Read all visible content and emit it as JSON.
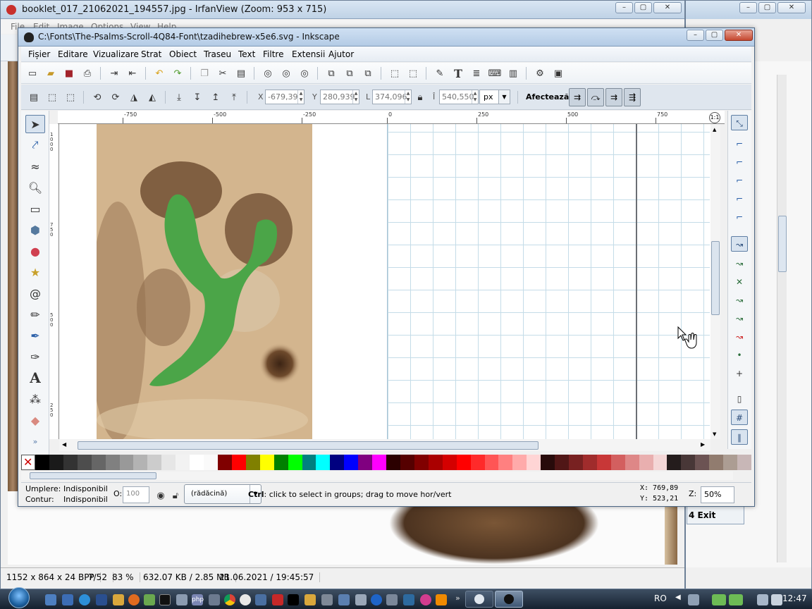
{
  "irfanview": {
    "title": "booklet_017_21062021_194557.jpg - IrfanView (Zoom: 953 x 715)",
    "menu": [
      "File",
      "Edit",
      "Image",
      "Options",
      "View",
      "Help"
    ],
    "status": [
      "1152 x 864 x 24 BPP",
      "7/52",
      "83 %",
      "632.07 KB / 2.85 MB",
      "21.06.2021 / 19:45:57"
    ],
    "exit_label": "4 Exit"
  },
  "inkscape": {
    "title": "C:\\Fonts\\The-Psalms-Scroll-4Q84-Font\\tzadihebrew-x5e6.svg - Inkscape",
    "menu": [
      "Fișier",
      "Editare",
      "Vizualizare",
      "Strat",
      "Obiect",
      "Traseu",
      "Text",
      "Filtre",
      "Extensii",
      "Ajutor"
    ],
    "controls": {
      "x_label": "X",
      "x_value": "-679,39",
      "y_label": "Y",
      "y_value": "280,939",
      "w_label": "L",
      "w_value": "374,096",
      "h_label": "Î",
      "h_value": "540,550",
      "unit": "px",
      "affect_label": "Afectează:"
    },
    "ruler_h": [
      "-750",
      "-500",
      "-250",
      "0",
      "250",
      "500",
      "750"
    ],
    "ruler_v": [
      "1000",
      "750",
      "500",
      "250"
    ],
    "status": {
      "fill_label": "Umplere:",
      "fill_value": "Indisponibil",
      "stroke_label": "Contur:",
      "stroke_value": "Indisponibil",
      "opacity_label": "O:",
      "opacity_value": "100",
      "layer": "(rădăcină)",
      "message_bold": "Ctrl",
      "message": ": click to select in groups; drag to move hor/vert",
      "x_coord": "X:  769,89",
      "y_coord": "Y:  523,21",
      "zoom_label": "Z:",
      "zoom_value": "50%"
    },
    "palette": [
      "#000000",
      "#1a1a1a",
      "#333333",
      "#4d4d4d",
      "#666666",
      "#808080",
      "#999999",
      "#b3b3b3",
      "#cccccc",
      "#e6e6e6",
      "#f2f2f2",
      "#ffffff",
      "#fafafa",
      "#800000",
      "#ff0000",
      "#808000",
      "#ffff00",
      "#008000",
      "#00ff00",
      "#008080",
      "#00ffff",
      "#000080",
      "#0000ff",
      "#800080",
      "#ff00ff",
      "#2b0000",
      "#550000",
      "#800000",
      "#aa0000",
      "#d40000",
      "#ff0000",
      "#ff2a2a",
      "#ff5555",
      "#ff8080",
      "#ffaaaa",
      "#ffd5d5",
      "#280b0b",
      "#501616",
      "#782121",
      "#a02c2c",
      "#c83737",
      "#d35f5f",
      "#de8787",
      "#e9afaf",
      "#f4d7d7",
      "#241c1c",
      "#483737",
      "#6c5353",
      "#917c6f",
      "#ac9d93",
      "#c8b7b7"
    ]
  },
  "taskbar": {
    "lang": "RO",
    "time": "12:47"
  }
}
